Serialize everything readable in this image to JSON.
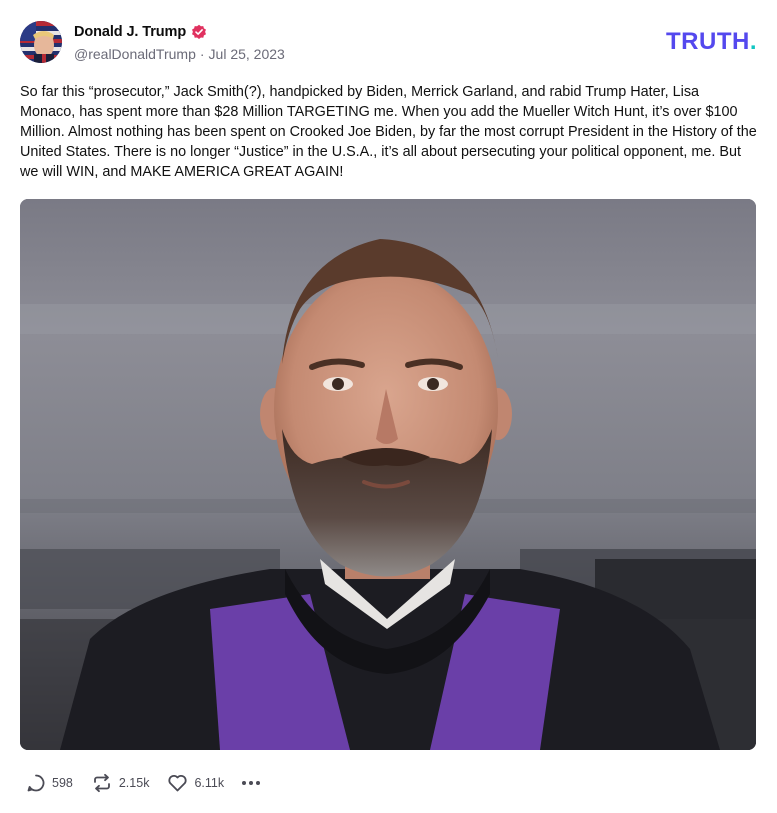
{
  "author": {
    "display_name": "Donald J. Trump",
    "handle": "@realDonaldTrump",
    "separator": "·",
    "date": "Jul 25, 2023",
    "verified": true
  },
  "brand": {
    "logo_text": "TRUTH",
    "logo_dot": "."
  },
  "post": {
    "text": "So far this “prosecutor,” Jack Smith(?), handpicked by Biden, Merrick Garland, and rabid Trump Hater, Lisa Monaco, has spent more than $28 Million TARGETING me. When you add the Mueller Witch Hunt, it’s over $100 Million. Almost nothing has been spent on Crooked Joe Biden, by far the most corrupt President in the History of the United States. There is no longer “Justice” in the U.S.A., it’s all about persecuting your political opponent, me. But we will WIN, and MAKE AMERICA GREAT AGAIN!"
  },
  "actions": {
    "replies": "598",
    "retruths": "2.15k",
    "likes": "6.11k"
  },
  "colors": {
    "brand": "#5448ee",
    "brand_dot": "#11c6c2",
    "verified": "#e0315f",
    "text": "#111111",
    "muted": "#6b6b78"
  },
  "icons": {
    "verified": "verified-badge-icon",
    "reply": "reply-bubble-icon",
    "retruth": "retruth-arrows-icon",
    "like": "heart-icon",
    "more": "ellipsis-icon"
  }
}
